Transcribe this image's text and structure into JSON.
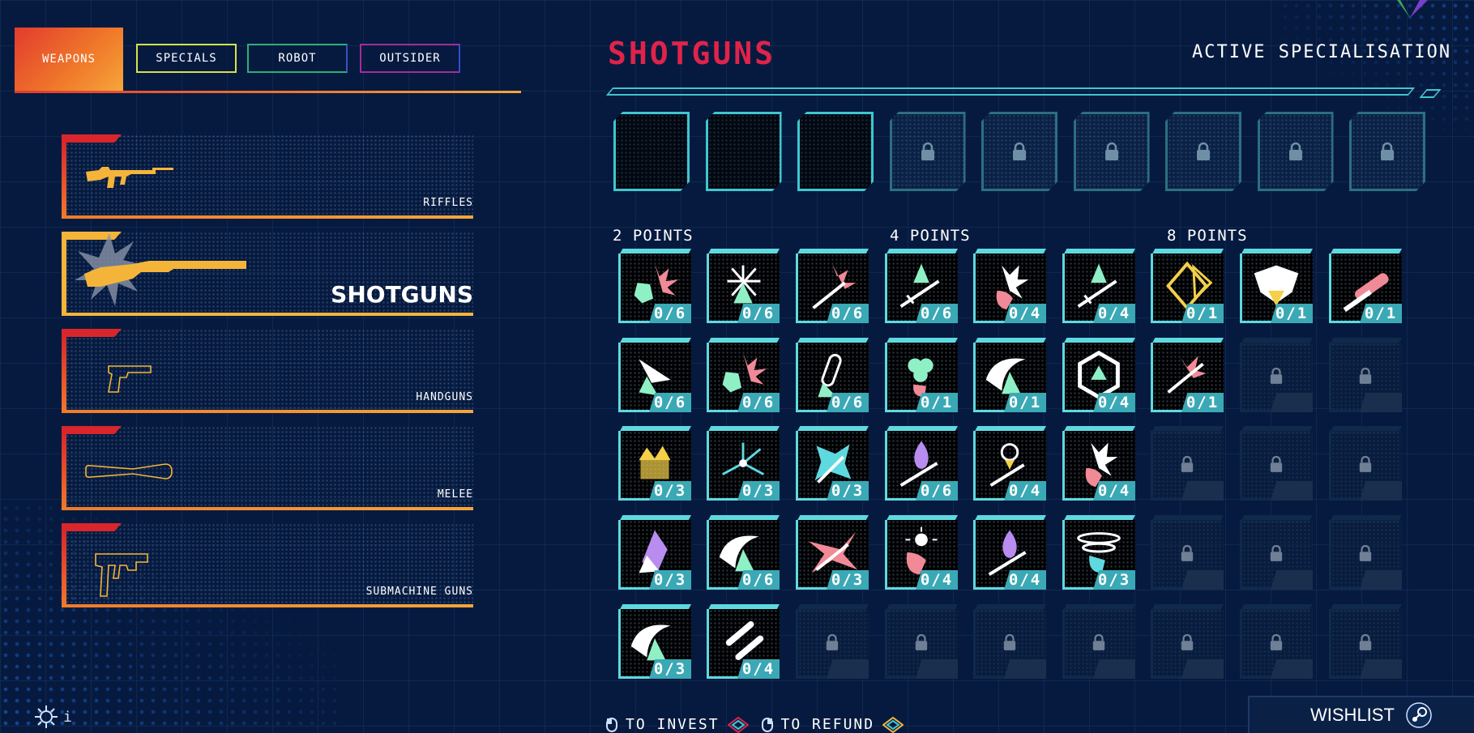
{
  "tabs": [
    {
      "label": "WEAPONS",
      "active": true,
      "color": "#f07a2a"
    },
    {
      "label": "SPECIALS",
      "active": false,
      "color": "#d6e24a"
    },
    {
      "label": "ROBOT",
      "active": false,
      "color": "#2fae7a"
    },
    {
      "label": "OUTSIDER",
      "active": false,
      "color": "#a42c9a"
    }
  ],
  "weapons": [
    {
      "label": "RIFFLES",
      "selected": false,
      "icon": "rifle-icon"
    },
    {
      "label": "SHOTGUNS",
      "selected": true,
      "icon": "shotgun-icon"
    },
    {
      "label": "HANDGUNS",
      "selected": false,
      "icon": "handgun-icon"
    },
    {
      "label": "MELEE",
      "selected": false,
      "icon": "melee-bat-icon"
    },
    {
      "label": "SUBMACHINE GUNS",
      "selected": false,
      "icon": "smg-icon"
    }
  ],
  "panel": {
    "title": "SHOTGUNS",
    "active_specialisation": "ACTIVE SPECIALISATION",
    "slots_unlocked": 3,
    "slots_total": 9
  },
  "groups": [
    {
      "label": "2 POINTS"
    },
    {
      "label": "4 POINTS"
    },
    {
      "label": "8 POINTS"
    }
  ],
  "grid": [
    [
      {
        "count": "0/6",
        "icon": "burst-icon"
      },
      {
        "count": "0/6",
        "icon": "spark-arrow-icon"
      },
      {
        "count": "0/6",
        "icon": "burst-gun-icon"
      },
      {
        "count": "0/6",
        "icon": "arrow-gun-icon"
      },
      {
        "count": "0/4",
        "icon": "hand-burst-icon"
      },
      {
        "count": "0/4",
        "icon": "arrow-gun-icon"
      },
      {
        "count": "0/1",
        "icon": "diamond-icon"
      },
      {
        "count": "0/1",
        "icon": "shield-icon"
      },
      {
        "count": "0/1",
        "icon": "shell-icon"
      }
    ],
    [
      {
        "count": "0/6",
        "icon": "arrow-hit-icon"
      },
      {
        "count": "0/6",
        "icon": "burst-icon"
      },
      {
        "count": "0/6",
        "icon": "capsule-icon"
      },
      {
        "count": "0/1",
        "icon": "clover-icon"
      },
      {
        "count": "0/1",
        "icon": "crescent-icon"
      },
      {
        "count": "0/4",
        "icon": "hex-icon"
      },
      {
        "count": "0/1",
        "icon": "shell-burst-icon"
      },
      {
        "locked": true
      },
      {
        "locked": true
      }
    ],
    [
      {
        "count": "0/3",
        "icon": "crown-icon"
      },
      {
        "count": "0/3",
        "icon": "molecule-icon"
      },
      {
        "count": "0/3",
        "icon": "teal-burst-icon"
      },
      {
        "count": "0/6",
        "icon": "flame-gun-icon"
      },
      {
        "count": "0/4",
        "icon": "flower-gun-icon"
      },
      {
        "count": "0/4",
        "icon": "hand-burst-icon"
      },
      {
        "locked": true
      },
      {
        "locked": true
      },
      {
        "locked": true
      }
    ],
    [
      {
        "count": "0/3",
        "icon": "purple-crystal-icon"
      },
      {
        "count": "0/6",
        "icon": "crescent-icon"
      },
      {
        "count": "0/3",
        "icon": "spikes-icon"
      },
      {
        "count": "0/4",
        "icon": "hand-sun-icon"
      },
      {
        "count": "0/4",
        "icon": "flame-gun-icon"
      },
      {
        "count": "0/3",
        "icon": "whirl-icon"
      },
      {
        "locked": true
      },
      {
        "locked": true
      },
      {
        "locked": true
      }
    ],
    [
      {
        "count": "0/3",
        "icon": "crescent-icon"
      },
      {
        "count": "0/4",
        "icon": "shells-icon"
      },
      {
        "locked": true
      },
      {
        "locked": true
      },
      {
        "locked": true
      },
      {
        "locked": true
      },
      {
        "locked": true
      },
      {
        "locked": true
      },
      {
        "locked": true
      }
    ]
  ],
  "footer": {
    "invest": "TO INVEST",
    "refund": "TO REFUND",
    "wishlist": "WISHLIST",
    "settings_text": "i"
  },
  "colors": {
    "title": "#e0234a",
    "accent": "#3fc6cf",
    "orange": "#f07a2a"
  }
}
